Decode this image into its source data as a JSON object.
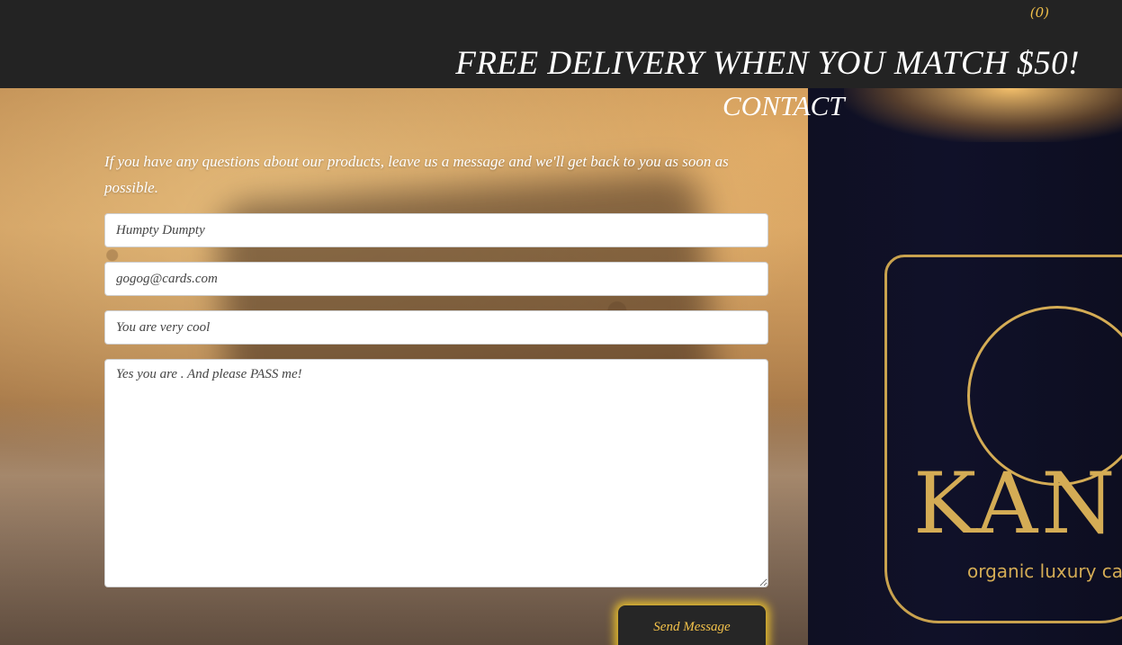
{
  "header": {
    "cart_count": "(0)",
    "promo_text": "FREE DELIVERY WHEN YOU MATCH $50!"
  },
  "contact": {
    "title": "CONTACT",
    "intro": "If you have any questions about our products, leave us a message and we'll get back to you as soon as possible.",
    "fields": {
      "name_value": "Humpty Dumpty",
      "email_value": "gogog@cards.com",
      "subject_value": "You are very cool",
      "message_value": "Yes you are . And please PASS me!"
    },
    "send_label": "Send Message"
  },
  "background": {
    "brand": "KANI",
    "tagline": "organic luxury cand"
  },
  "colors": {
    "accent": "#f2c14a",
    "topbar": "#232323",
    "button_glow": "#ffd228"
  }
}
